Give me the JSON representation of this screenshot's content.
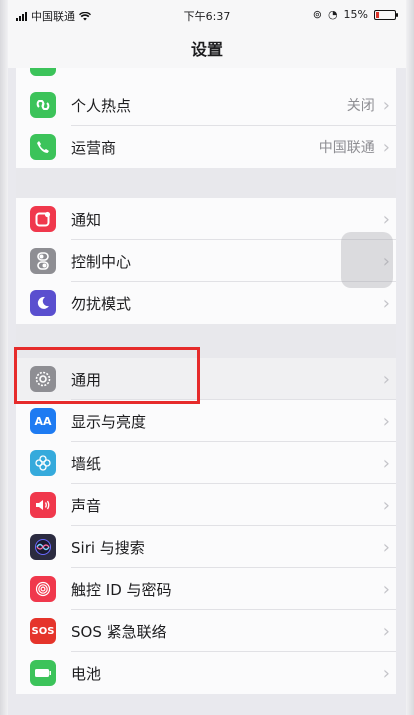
{
  "status": {
    "carrier": "中国联通",
    "time": "下午6:37",
    "battery": "15%",
    "battery_level": 0.15
  },
  "nav": {
    "title": "设置"
  },
  "groups": [
    {
      "items": [
        {
          "name": "hotspot",
          "label": "个人热点",
          "value": "关闭",
          "icon": "hotspot-icon",
          "color": "#3cc35a"
        },
        {
          "name": "carrier",
          "label": "运营商",
          "value": "中国联通",
          "icon": "phone-icon",
          "color": "#3cc35a"
        }
      ]
    },
    {
      "items": [
        {
          "name": "notifications",
          "label": "通知",
          "value": "",
          "icon": "notifications-icon",
          "color": "#f0384c"
        },
        {
          "name": "control-center",
          "label": "控制中心",
          "value": "",
          "icon": "control-center-icon",
          "color": "#8e8e93"
        },
        {
          "name": "do-not-disturb",
          "label": "勿扰模式",
          "value": "",
          "icon": "moon-icon",
          "color": "#5a4fcf"
        }
      ]
    },
    {
      "items": [
        {
          "name": "general",
          "label": "通用",
          "value": "",
          "icon": "gear-icon",
          "color": "#8e8e93"
        },
        {
          "name": "display-brightness",
          "label": "显示与亮度",
          "value": "",
          "icon": "display-icon",
          "color": "#1e7bf2"
        },
        {
          "name": "wallpaper",
          "label": "墙纸",
          "value": "",
          "icon": "wallpaper-icon",
          "color": "#35aadc"
        },
        {
          "name": "sounds",
          "label": "声音",
          "value": "",
          "icon": "speaker-icon",
          "color": "#f0384c"
        },
        {
          "name": "siri-search",
          "label": "Siri 与搜索",
          "value": "",
          "icon": "siri-icon",
          "color": "#2b2b40"
        },
        {
          "name": "touch-id-passcode",
          "label": "触控 ID 与密码",
          "value": "",
          "icon": "fingerprint-icon",
          "color": "#f0384c"
        },
        {
          "name": "emergency-sos",
          "label": "SOS 紧急联络",
          "value": "",
          "icon": "sos-icon",
          "color": "#e5342b"
        },
        {
          "name": "battery",
          "label": "电池",
          "value": "",
          "icon": "battery-icon",
          "color": "#3cc35a"
        }
      ]
    }
  ],
  "colors": {
    "highlight": "#e62b2b",
    "chevron": "#c4c4c9"
  }
}
